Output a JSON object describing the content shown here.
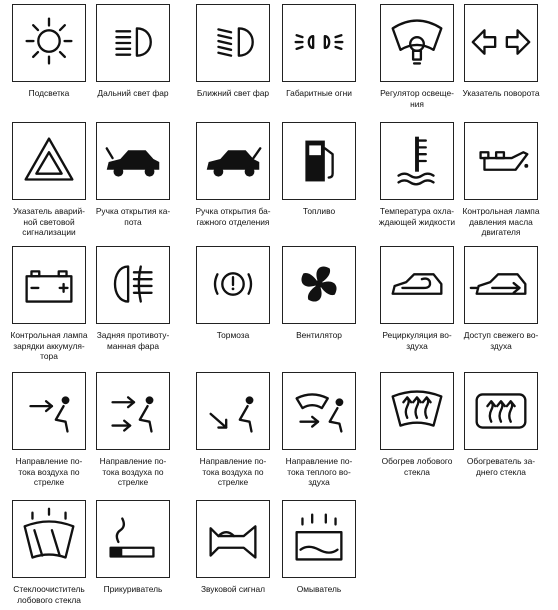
{
  "rows": [
    [
      {
        "icon": "instrument-illumination-icon",
        "caption": [
          "Подсветка"
        ]
      },
      {
        "icon": "high-beam-icon",
        "caption": [
          "Дальний свет фар"
        ]
      },
      {
        "icon": "low-beam-icon",
        "caption": [
          "Ближний свет фар"
        ]
      },
      {
        "icon": "side-lights-icon",
        "caption": [
          "Габаритные огни"
        ]
      },
      {
        "icon": "lighting-regulator-icon",
        "caption": [
          "Регулятор освеще-",
          "ния"
        ]
      },
      {
        "icon": "turn-signal-icon",
        "caption": [
          "Указатель поворота"
        ]
      }
    ],
    [
      {
        "icon": "hazard-warning-icon",
        "caption": [
          "Указатель аварий-",
          "ной световой",
          "сигнализации"
        ]
      },
      {
        "icon": "hood-release-icon",
        "caption": [
          "Ручка открытия ка-",
          "пота"
        ]
      },
      {
        "icon": "trunk-release-icon",
        "caption": [
          "Ручка открытия ба-",
          "гажного отделения"
        ]
      },
      {
        "icon": "fuel-icon",
        "caption": [
          "Топливо"
        ]
      },
      {
        "icon": "coolant-temperature-icon",
        "caption": [
          "Температура охла-",
          "ждающей жидкости"
        ]
      },
      {
        "icon": "oil-pressure-icon",
        "caption": [
          "Контрольная лампа",
          "давления масла",
          "двигателя"
        ]
      }
    ],
    [
      {
        "icon": "battery-icon",
        "caption": [
          "Контрольная лампа",
          "зарядки аккумуля-",
          "тора"
        ]
      },
      {
        "icon": "rear-fog-lamp-icon",
        "caption": [
          "Задняя противоту-",
          "манная фара"
        ]
      },
      {
        "icon": "brake-icon",
        "caption": [
          "Тормоза"
        ]
      },
      {
        "icon": "fan-icon",
        "caption": [
          "Вентилятор"
        ]
      },
      {
        "icon": "air-recirculation-icon",
        "caption": [
          "Рециркуляция во-",
          "здуха"
        ]
      },
      {
        "icon": "fresh-air-icon",
        "caption": [
          "Доступ свежего во-",
          "здуха"
        ]
      }
    ],
    [
      {
        "icon": "airflow-face-icon",
        "caption": [
          "Направление по-",
          "тока воздуха по",
          "стрелке"
        ]
      },
      {
        "icon": "airflow-face-feet-icon",
        "caption": [
          "Направление по-",
          "тока воздуха по",
          "стрелке"
        ]
      },
      {
        "icon": "airflow-feet-icon",
        "caption": [
          "Направление по-",
          "тока воздуха по",
          "стрелке"
        ]
      },
      {
        "icon": "warm-airflow-icon",
        "caption": [
          "Направление по-",
          "тока теплого во-",
          "здуха"
        ]
      },
      {
        "icon": "windshield-defrost-icon",
        "caption": [
          "Обогрев лобового",
          "стекла"
        ]
      },
      {
        "icon": "rear-window-defrost-icon",
        "caption": [
          "Обогреватель за-",
          "днего стекла"
        ]
      }
    ],
    [
      {
        "icon": "windshield-wiper-icon",
        "caption": [
          "Стеклоочиститель",
          "лобового стекла"
        ]
      },
      {
        "icon": "cigarette-lighter-icon",
        "caption": [
          "Прикуриватель"
        ]
      },
      {
        "icon": "horn-icon",
        "caption": [
          "Звуковой сигнал"
        ]
      },
      {
        "icon": "washer-icon",
        "caption": [
          "Омыватель"
        ]
      }
    ]
  ]
}
